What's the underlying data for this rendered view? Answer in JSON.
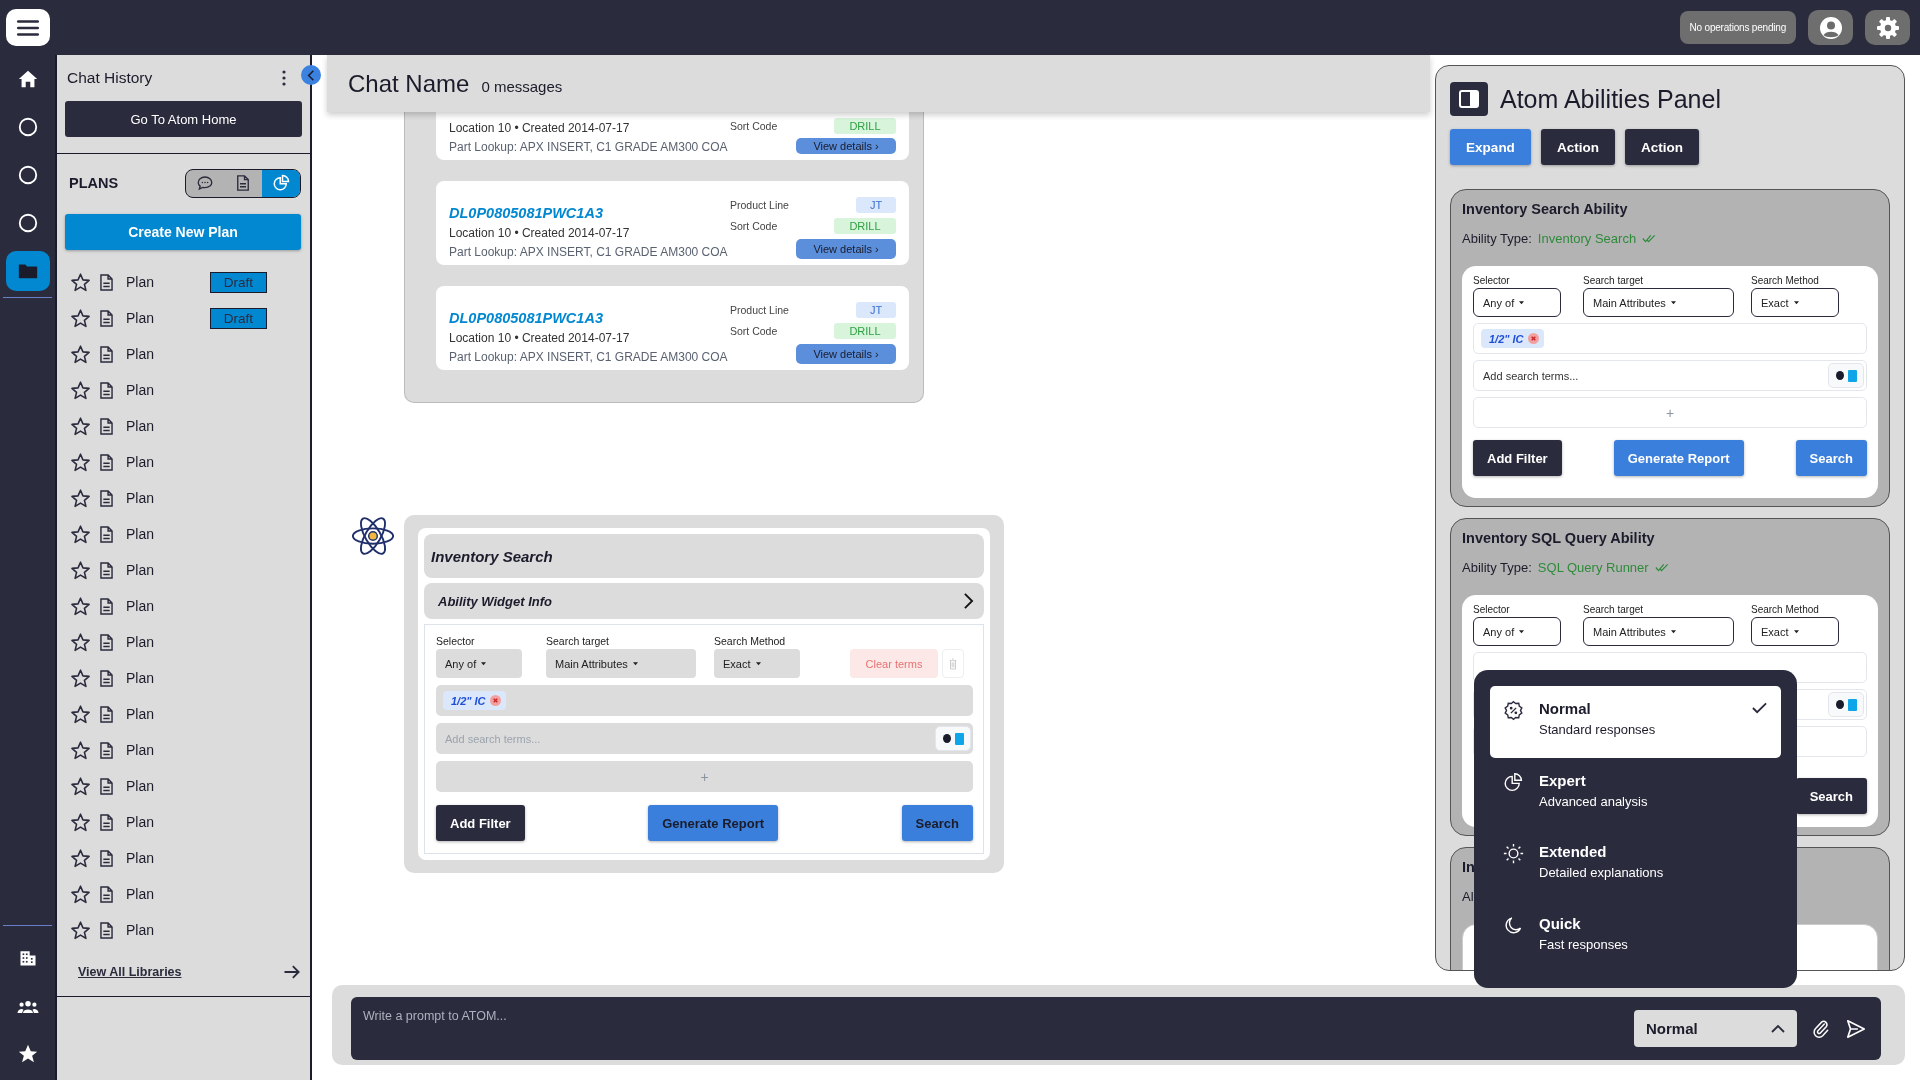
{
  "top_bar": {
    "status": "No operations pending"
  },
  "rail": {
    "items": [
      {
        "selected": false
      },
      {
        "selected": false
      },
      {
        "selected": false
      },
      {
        "selected": false
      },
      {
        "selected": true
      }
    ]
  },
  "sidebar": {
    "title": "Chat History",
    "home_button": "Go To Atom Home",
    "plans_heading": "PLANS",
    "view_toggle": [
      {
        "selected": false
      },
      {
        "selected": false
      },
      {
        "selected": true
      }
    ],
    "create_button": "Create New Plan",
    "plans": [
      {
        "label": "Plan",
        "badge": "Draft"
      },
      {
        "label": "Plan",
        "badge": "Draft"
      },
      {
        "label": "Plan"
      },
      {
        "label": "Plan"
      },
      {
        "label": "Plan"
      },
      {
        "label": "Plan"
      },
      {
        "label": "Plan"
      },
      {
        "label": "Plan"
      },
      {
        "label": "Plan"
      },
      {
        "label": "Plan"
      },
      {
        "label": "Plan"
      },
      {
        "label": "Plan"
      },
      {
        "label": "Plan"
      },
      {
        "label": "Plan"
      },
      {
        "label": "Plan"
      },
      {
        "label": "Plan"
      },
      {
        "label": "Plan"
      },
      {
        "label": "Plan"
      },
      {
        "label": "Plan"
      }
    ],
    "footer_link": "View All Libraries"
  },
  "chat": {
    "name": "Chat Name",
    "count": "0 messages"
  },
  "results": [
    {
      "location": "Location 10 • Created 2014-07-17",
      "part_lookup": "Part Lookup: APX INSERT, C1 GRADE AM300 COA",
      "sort_code_label": "Sort Code",
      "sort_code": "DRILL",
      "button": "View details ›"
    },
    {
      "id": "DL0P0805081PWC1A3",
      "location": "Location 10 • Created 2014-07-17",
      "part_lookup": "Part Lookup: APX INSERT, C1 GRADE AM300 COA",
      "product_line_label": "Product Line",
      "product_line": "JT",
      "sort_code_label": "Sort Code",
      "sort_code": "DRILL",
      "button": "View details ›"
    },
    {
      "id": "DL0P0805081PWC1A3",
      "location": "Location 10 • Created 2014-07-17",
      "part_lookup": "Part Lookup: APX INSERT, C1 GRADE AM300 COA",
      "product_line_label": "Product Line",
      "product_line": "JT",
      "sort_code_label": "Sort Code",
      "sort_code": "DRILL",
      "button": "View details ›"
    }
  ],
  "widget": {
    "title": "Inventory Search",
    "info": "Ability Widget Info",
    "form": {
      "labels": [
        "Selector",
        "Search target",
        "Search Method"
      ],
      "selects": [
        "Any of",
        "Main Attributes",
        "Exact"
      ],
      "clear": "Clear terms",
      "tag": "1/2\" IC",
      "placeholder": "Add search terms...",
      "add_row": "+",
      "buttons": [
        {
          "label": "Add Filter",
          "kind": "dark"
        },
        {
          "label": "Generate Report",
          "kind": "primary"
        },
        {
          "label": "Search",
          "kind": "primary"
        }
      ]
    }
  },
  "panel": {
    "title": "Atom Abilities Panel",
    "buttons": [
      {
        "label": "Expand",
        "kind": "primary"
      },
      {
        "label": "Action",
        "kind": "dark"
      },
      {
        "label": "Action",
        "kind": "dark"
      }
    ],
    "abilities": [
      {
        "title": "Inventory Search Ability",
        "type_label": "Ability Type:",
        "type": "Inventory Search",
        "form": {
          "labels": [
            "Selector",
            "Search target",
            "Search Method"
          ],
          "selects": [
            "Any of",
            "Main Attributes",
            "Exact"
          ],
          "tag": "1/2\" IC",
          "placeholder": "Add search terms...",
          "add_row": "+",
          "buttons": [
            {
              "label": "Add Filter",
              "kind": "dark"
            },
            {
              "label": "Generate Report",
              "kind": "primary"
            },
            {
              "label": "Search",
              "kind": "primary"
            }
          ]
        }
      },
      {
        "title": "Inventory SQL Query Ability",
        "type_label": "Ability Type:",
        "type": "SQL Query Runner",
        "form": {
          "labels": [
            "Selector",
            "Search target",
            "Search Method"
          ],
          "selects": [
            "Any of",
            "Main Attributes",
            "Exact"
          ],
          "buttons": [
            {
              "label": "Search",
              "kind": "dark"
            }
          ]
        }
      },
      {
        "title": "In",
        "type_label": "Al"
      }
    ]
  },
  "prompt": {
    "placeholder": "Write a prompt to ATOM...",
    "mode": "Normal",
    "expanded": true
  },
  "mode_menu": [
    {
      "label": "Normal",
      "description": "Standard responses",
      "selected": true
    },
    {
      "label": "Expert",
      "description": "Advanced analysis",
      "selected": false
    },
    {
      "label": "Extended",
      "description": "Detailed explanations",
      "selected": false
    },
    {
      "label": "Quick",
      "description": "Fast responses",
      "selected": false
    }
  ]
}
